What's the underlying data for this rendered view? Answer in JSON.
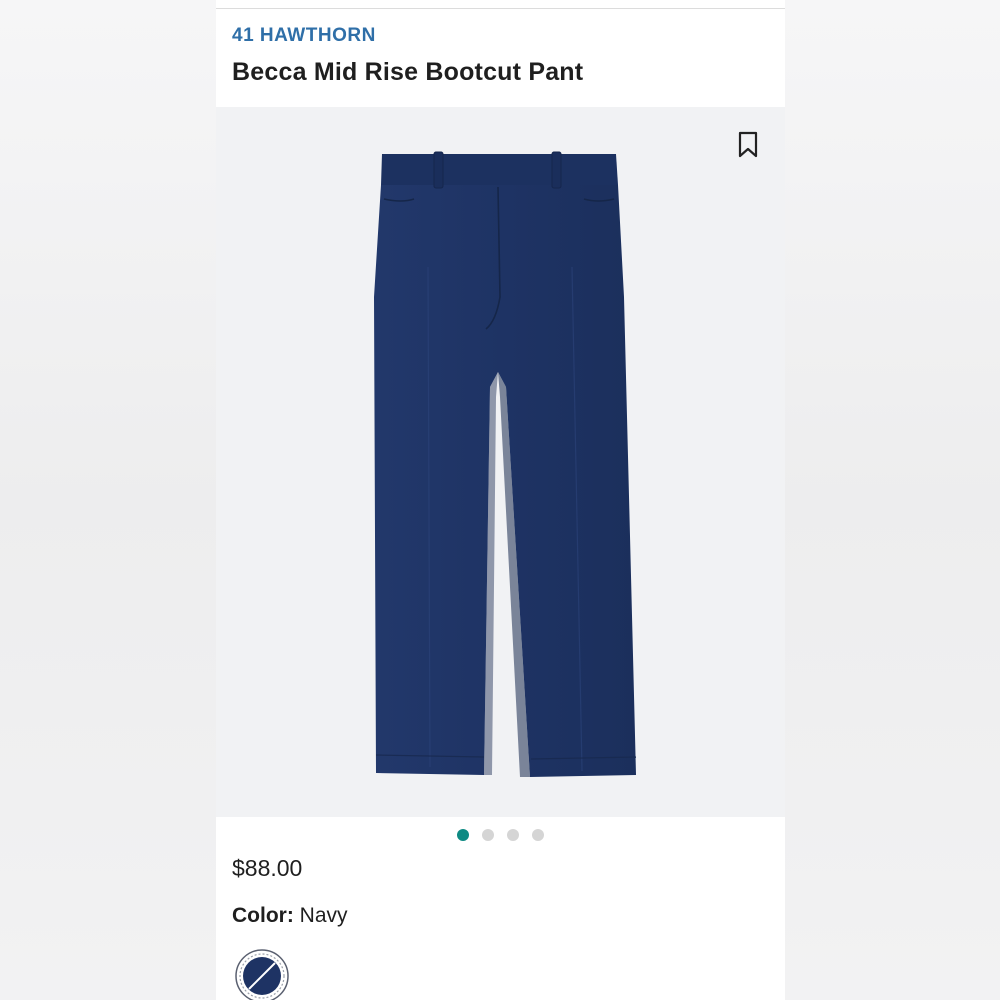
{
  "product": {
    "brand": "41 HAWTHORN",
    "name": "Becca Mid Rise Bootcut Pant",
    "price": "$88.00",
    "color_label": "Color:",
    "color_value": "Navy"
  },
  "gallery": {
    "image_count": 4,
    "active_index": 0,
    "active_color": "#0e8a83",
    "inactive_color": "#d5d5d5"
  },
  "icons": {
    "bookmark": "bookmark-icon",
    "swatch": "color-swatch-navy"
  },
  "colors": {
    "brand": "#2f6fa8",
    "product_fabric": "#1e3364",
    "swatch": "#1e3364"
  }
}
